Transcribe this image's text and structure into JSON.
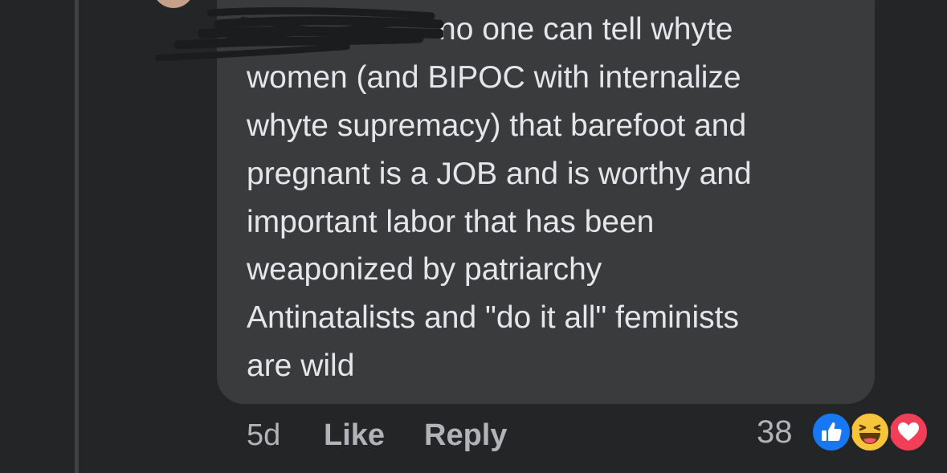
{
  "comment": {
    "author_hidden": true,
    "lines": [
      "no one can tell whyte",
      "women (and BIPOC with internalize",
      "whyte supremacy) that barefoot and",
      "pregnant is a JOB and is worthy and",
      "important labor that has been",
      "weaponized by patriarchy",
      "Antinatalists and \"do it all\" feminists",
      "are wild"
    ]
  },
  "actions": {
    "time": "5d",
    "like_label": "Like",
    "reply_label": "Reply"
  },
  "reactions": {
    "count": "38",
    "icons": [
      "like-icon",
      "haha-icon",
      "love-icon"
    ]
  },
  "colors": {
    "background": "#242526",
    "bubble": "#3a3b3c",
    "text": "#e4e6eb",
    "secondary_text": "#b0b3b8",
    "like_blue": "#1877f2",
    "haha_yellow": "#f7c53c",
    "love_red": "#f33e58"
  }
}
